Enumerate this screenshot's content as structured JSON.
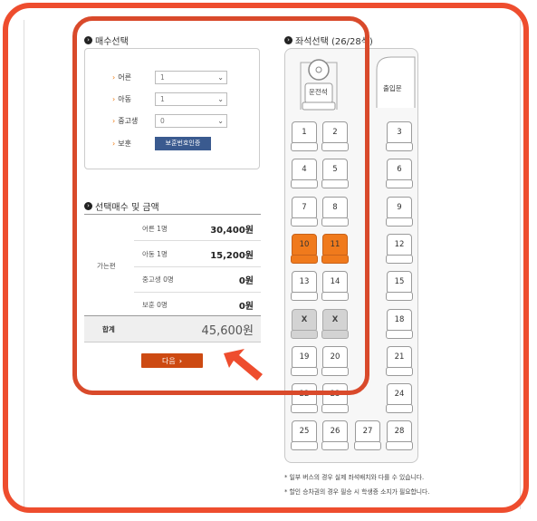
{
  "quantity_section": {
    "title": "매수선택"
  },
  "fields": [
    {
      "label": "어른",
      "value": "1",
      "type": "select"
    },
    {
      "label": "아동",
      "value": "1",
      "type": "select"
    },
    {
      "label": "중고생",
      "value": "0",
      "type": "select"
    },
    {
      "label": "보훈",
      "button": "보훈번호인증",
      "type": "button"
    }
  ],
  "summary_section": {
    "title": "선택매수 및 금액"
  },
  "summary": {
    "group_label": "가는편",
    "rows": [
      {
        "label": "어른 1명",
        "amount": "30,400원"
      },
      {
        "label": "아동 1명",
        "amount": "15,200원"
      },
      {
        "label": "중고생 0명",
        "amount": "0원"
      },
      {
        "label": "보훈 0명",
        "amount": "0원"
      }
    ],
    "total_label": "합계",
    "total_amount": "45,600원"
  },
  "next_button": {
    "label": "다음",
    "icon": "chevron-right-icon"
  },
  "seat_section": {
    "title": "좌석선택 (26/28석)"
  },
  "bus": {
    "driver_label": "운전석",
    "door_label": "출입문"
  },
  "seats": [
    {
      "label": "1",
      "status": "available"
    },
    {
      "label": "2",
      "status": "available"
    },
    {
      "label": "3",
      "status": "available"
    },
    {
      "label": "4",
      "status": "available"
    },
    {
      "label": "5",
      "status": "available"
    },
    {
      "label": "6",
      "status": "available"
    },
    {
      "label": "7",
      "status": "available"
    },
    {
      "label": "8",
      "status": "available"
    },
    {
      "label": "9",
      "status": "available"
    },
    {
      "label": "10",
      "status": "selected"
    },
    {
      "label": "11",
      "status": "selected"
    },
    {
      "label": "12",
      "status": "available"
    },
    {
      "label": "13",
      "status": "available"
    },
    {
      "label": "14",
      "status": "available"
    },
    {
      "label": "15",
      "status": "available"
    },
    {
      "label": "X",
      "status": "taken"
    },
    {
      "label": "X",
      "status": "taken"
    },
    {
      "label": "18",
      "status": "available"
    },
    {
      "label": "19",
      "status": "available"
    },
    {
      "label": "20",
      "status": "available"
    },
    {
      "label": "21",
      "status": "available"
    },
    {
      "label": "22",
      "status": "available"
    },
    {
      "label": "23",
      "status": "available"
    },
    {
      "label": "24",
      "status": "available"
    },
    {
      "label": "25",
      "status": "available"
    },
    {
      "label": "26",
      "status": "available"
    },
    {
      "label": "27",
      "status": "available"
    },
    {
      "label": "28",
      "status": "available"
    }
  ],
  "notes": [
    "* 일부 버스의 경우 실제 좌석배치와 다를 수 있습니다.",
    "* 할인 승차권의 경우 필승 시 학생증 소지가 필요합니다."
  ],
  "colors": {
    "highlight": "#ee4d2e",
    "selected_seat": "#f07a1c",
    "next_button": "#cd4a12",
    "verify_button": "#3a5a8f"
  }
}
